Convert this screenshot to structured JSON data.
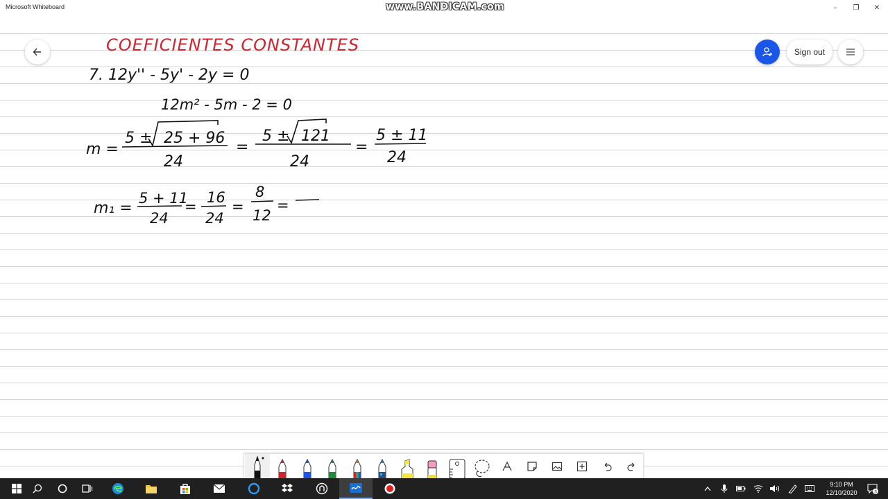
{
  "window": {
    "title": "Microsoft Whiteboard",
    "watermark": "www.BANDICAM.com",
    "controls": {
      "minimize": "–",
      "restore": "❐",
      "close": "✕"
    }
  },
  "whiteboard": {
    "header_buttons": {
      "sign_out_label": "Sign out"
    },
    "ink": {
      "title": "COEFICIENTES CONSTANTES",
      "title_color": "#d1242f",
      "ink_color": "#111111",
      "line1": "7.  12y'' - 5y' - 2y = 0",
      "line2": "12m² - 5m - 2 = 0",
      "m_label": "m =",
      "frac1": {
        "num_prefix": "5 ±",
        "radicand": "25 + 96",
        "den": "24"
      },
      "frac2": {
        "num_prefix": "5 ±",
        "radicand": "121",
        "den": "24"
      },
      "frac3": {
        "num": "5 ± 11",
        "den": "24"
      },
      "m1_label": "m₁ =",
      "m1_frac1": {
        "num": "5 + 11",
        "den": "24"
      },
      "m1_frac2": {
        "num": "16",
        "den": "24"
      },
      "m1_frac3": {
        "num": "8",
        "den": "12"
      },
      "equals": "="
    },
    "accent_color": "#1a57e8"
  },
  "toolbar": {
    "tools": [
      "pen-black",
      "pen-red",
      "pen-blue",
      "pen-green",
      "pen-rainbow",
      "pen-galaxy",
      "highlighter-yellow",
      "eraser",
      "ruler",
      "lasso",
      "text-tool",
      "sticky-note",
      "image",
      "add",
      "undo",
      "redo"
    ]
  },
  "taskbar": {
    "clock_time": "9:10 PM",
    "clock_date": "12/10/2020",
    "notification_count": "3"
  }
}
